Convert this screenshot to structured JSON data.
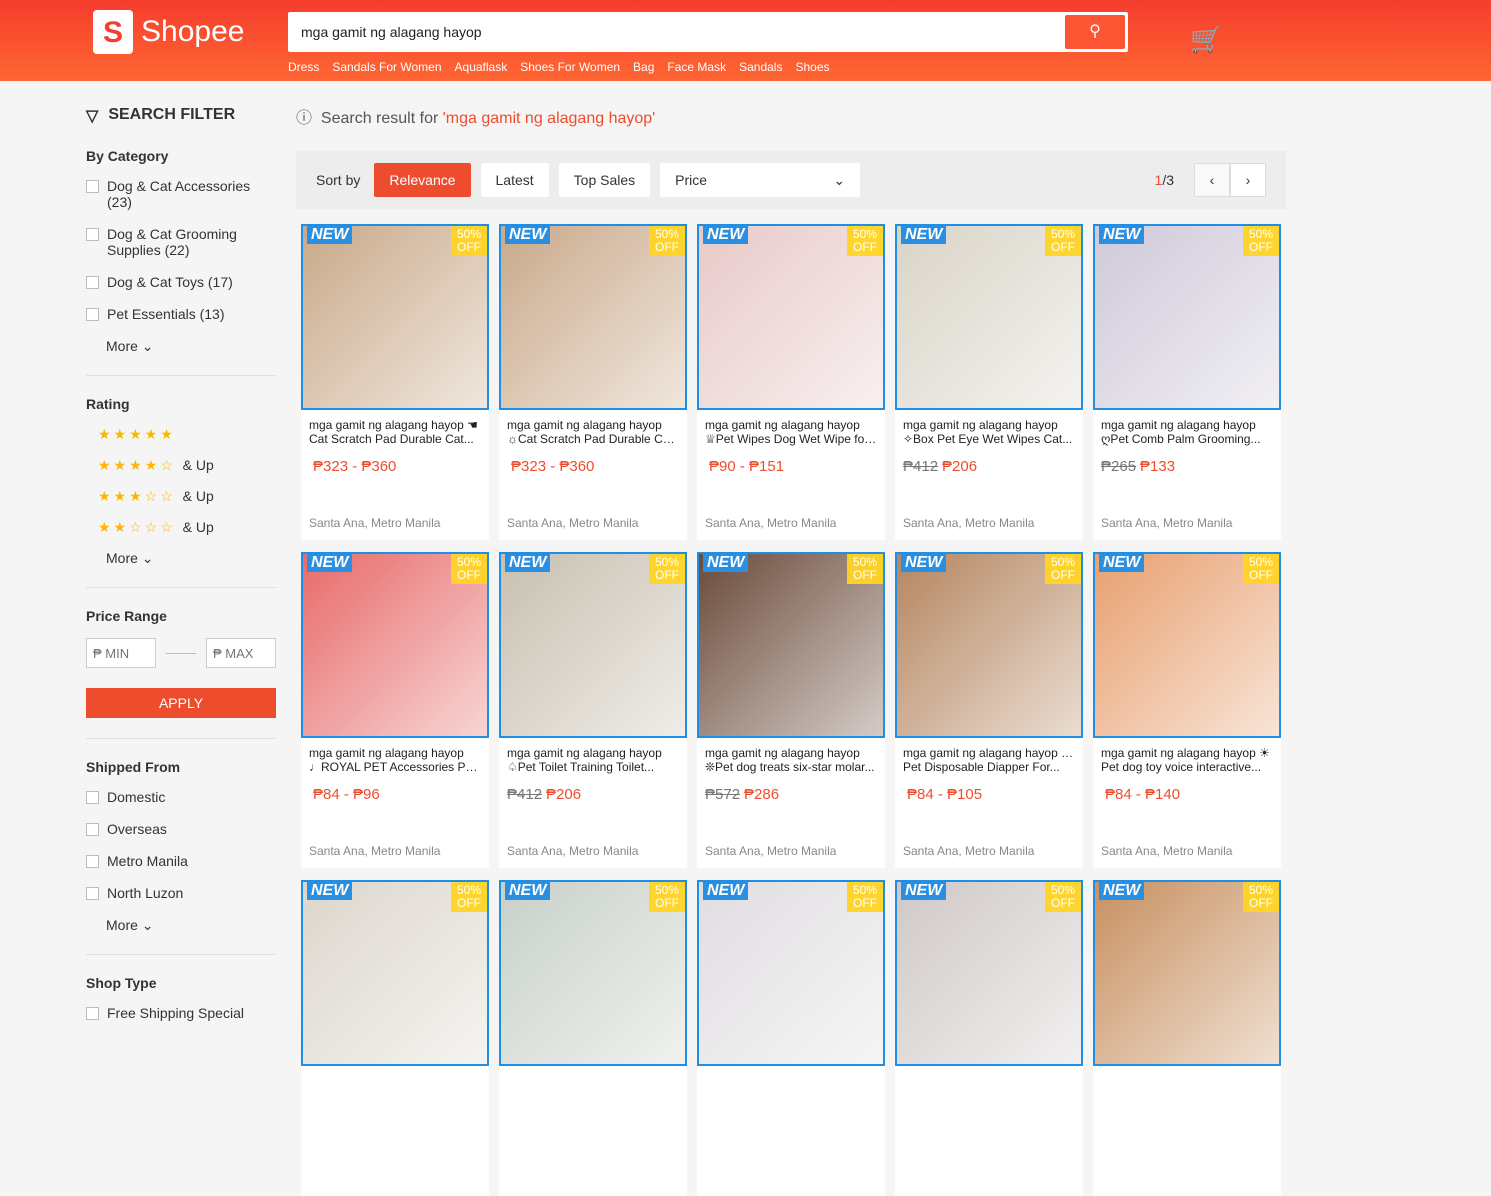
{
  "header": {
    "logo": "Shopee",
    "search_value": "mga gamit ng alagang hayop",
    "tags": [
      "Dress",
      "Sandals For Women",
      "Aquaflask",
      "Shoes For Women",
      "Bag",
      "Face Mask",
      "Sandals",
      "Shoes"
    ]
  },
  "sidebar": {
    "title": "SEARCH FILTER",
    "category": {
      "label": "By Category",
      "items": [
        "Dog & Cat Accessories (23)",
        "Dog & Cat Grooming Supplies (22)",
        "Dog & Cat Toys (17)",
        "Pet Essentials (13)"
      ],
      "more": "More"
    },
    "rating": {
      "label": "Rating",
      "levels": [
        5,
        4,
        3,
        2
      ],
      "suffix": "& Up",
      "more": "More"
    },
    "price_range": {
      "label": "Price Range",
      "min_placeholder": "₱ MIN",
      "max_placeholder": "₱ MAX",
      "apply": "APPLY"
    },
    "shipped_from": {
      "label": "Shipped From",
      "items": [
        "Domestic",
        "Overseas",
        "Metro Manila",
        "North Luzon"
      ],
      "more": "More"
    },
    "shop_type": {
      "label": "Shop Type",
      "items": [
        "Free Shipping Special"
      ]
    }
  },
  "result": {
    "prefix": "Search result for ",
    "query": "'mga gamit ng alagang hayop'"
  },
  "sort": {
    "label": "Sort by",
    "options": [
      "Relevance",
      "Latest",
      "Top Sales"
    ],
    "active": "Relevance",
    "price": "Price",
    "page_current": "1",
    "page_total": "/3"
  },
  "badges": {
    "new": "NEW",
    "off_pct": "50%",
    "off": "OFF"
  },
  "products": [
    {
      "title1": "mga gamit ng alagang hayop ☚",
      "title2": "Cat Scratch Pad Durable Cat...",
      "old": "",
      "price": "₱323 - ₱360",
      "loc": "Santa Ana, Metro Manila",
      "color": "#c9a98a"
    },
    {
      "title1": "mga gamit ng alagang hayop",
      "title2": "☼Cat Scratch Pad Durable Cat...",
      "old": "",
      "price": "₱323 - ₱360",
      "loc": "Santa Ana, Metro Manila",
      "color": "#c9a98a"
    },
    {
      "title1": "mga gamit ng alagang hayop",
      "title2": "♕Pet Wipes Dog Wet Wipe for...",
      "old": "",
      "price": "₱90 - ₱151",
      "loc": "Santa Ana, Metro Manila",
      "color": "#e8c9c9"
    },
    {
      "title1": "mga gamit ng alagang hayop",
      "title2": "✧Box Pet Eye Wet Wipes Cat...",
      "old": "₱412",
      "price": "₱206",
      "loc": "Santa Ana, Metro Manila",
      "color": "#d9d4c8"
    },
    {
      "title1": "mga gamit ng alagang hayop",
      "title2": "ღPet Comb Palm Grooming...",
      "old": "₱265",
      "price": "₱133",
      "loc": "Santa Ana, Metro Manila",
      "color": "#cfc9d9"
    },
    {
      "title1": "mga gamit ng alagang hayop",
      "title2": "♩ROYAL PET Accessories Pet...",
      "old": "",
      "price": "₱84 - ₱96",
      "loc": "Santa Ana, Metro Manila",
      "color": "#e86a6a"
    },
    {
      "title1": "mga gamit ng alagang hayop",
      "title2": "♤Pet Toilet Training Toilet...",
      "old": "₱412",
      "price": "₱206",
      "loc": "Santa Ana, Metro Manila",
      "color": "#c8c0b0"
    },
    {
      "title1": "mga gamit ng alagang hayop",
      "title2": "❊Pet dog treats six-star molar...",
      "old": "₱572",
      "price": "₱286",
      "loc": "Santa Ana, Metro Manila",
      "color": "#6a4a3a"
    },
    {
      "title1": "mga gamit ng alagang hayop ✌",
      "title2": "Pet Disposable Diapper For...",
      "old": "",
      "price": "₱84 - ₱105",
      "loc": "Santa Ana, Metro Manila",
      "color": "#b58660"
    },
    {
      "title1": "mga gamit ng alagang hayop ☀",
      "title2": "Pet dog toy voice interactive...",
      "old": "",
      "price": "₱84 - ₱140",
      "loc": "Santa Ana, Metro Manila",
      "color": "#e8a070"
    },
    {
      "title1": "",
      "title2": "",
      "old": "",
      "price": "",
      "loc": "",
      "color": "#dcd6cc"
    },
    {
      "title1": "",
      "title2": "",
      "old": "",
      "price": "",
      "loc": "",
      "color": "#c8d0c8"
    },
    {
      "title1": "",
      "title2": "",
      "old": "",
      "price": "",
      "loc": "",
      "color": "#e0dde0"
    },
    {
      "title1": "",
      "title2": "",
      "old": "",
      "price": "",
      "loc": "",
      "color": "#d0c8c8"
    },
    {
      "title1": "",
      "title2": "",
      "old": "",
      "price": "",
      "loc": "",
      "color": "#c89060"
    }
  ],
  "colors": {
    "brand": "#ee4d2d"
  }
}
